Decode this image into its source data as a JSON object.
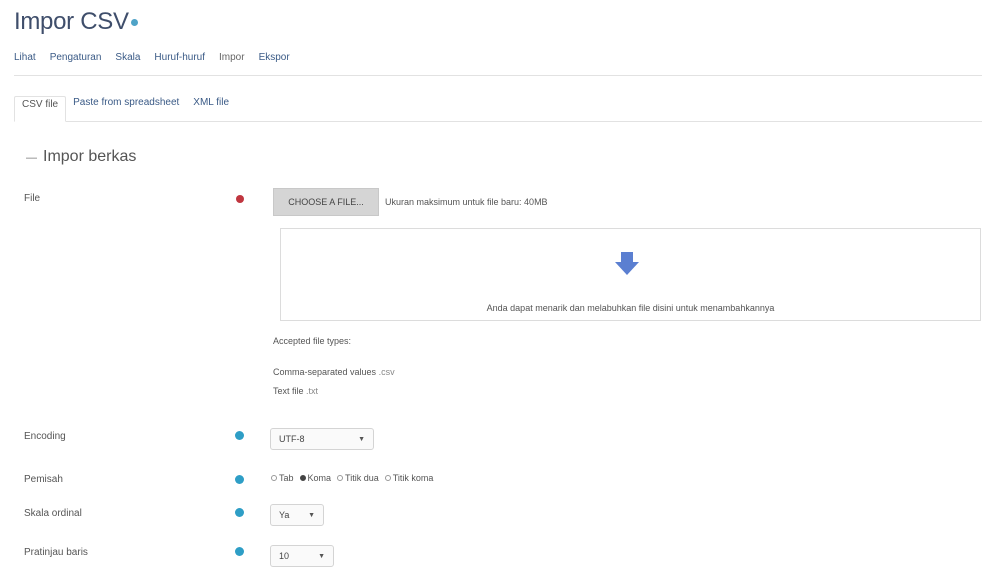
{
  "page": {
    "title": "Impor CSV"
  },
  "tabs_main": [
    "Lihat",
    "Pengaturan",
    "Skala",
    "Huruf-huruf",
    "Impor",
    "Ekspor"
  ],
  "tabs_sub": [
    "CSV file",
    "Paste from spreadsheet",
    "XML file"
  ],
  "section": {
    "title": "Impor berkas"
  },
  "file_field": {
    "label": "File",
    "button": "CHOOSE A FILE...",
    "max_size": "Ukuran maksimum untuk file baru: 40MB",
    "drop_hint": "Anda dapat menarik dan melabuhkan file disini untuk menambahkannya",
    "accepted_label": "Accepted file types:",
    "types": [
      {
        "name": "Comma-separated values",
        "ext": ".csv"
      },
      {
        "name": "Text file",
        "ext": ".txt"
      }
    ]
  },
  "encoding": {
    "label": "Encoding",
    "value": "UTF-8"
  },
  "separator": {
    "label": "Pemisah",
    "options": [
      "Tab",
      "Koma",
      "Titik dua",
      "Titik koma"
    ],
    "selected": 1
  },
  "scale": {
    "label": "Skala ordinal",
    "value": "Ya"
  },
  "first_row": {
    "label": "Pratinjau baris",
    "value": "10"
  },
  "colors": {
    "title": "#3f4e6b",
    "link": "#3a5a86",
    "required": "#c0363f",
    "info": "#2e9ec6",
    "arrow": "#5b7fd1"
  }
}
